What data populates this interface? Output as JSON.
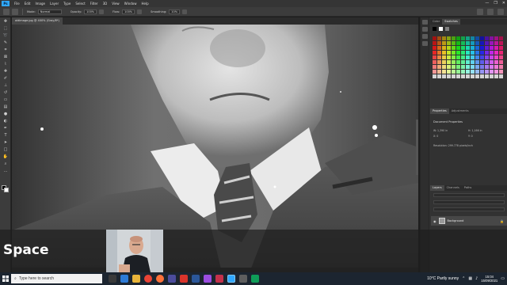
{
  "menubar": {
    "logo": "Ps",
    "items": [
      "File",
      "Edit",
      "Image",
      "Layer",
      "Type",
      "Select",
      "Filter",
      "3D",
      "View",
      "Window",
      "Help"
    ],
    "controls": [
      "—",
      "❐",
      "✕"
    ]
  },
  "options": {
    "mode_label": "Mode:",
    "mode_value": "Normal",
    "opacity_label": "Opacity:",
    "opacity_value": "100%",
    "flow_label": "Flow:",
    "flow_value": "100%",
    "smoothing_label": "Smoothing:",
    "smoothing_value": "10%"
  },
  "document": {
    "tab_label": "oldimage.jpg @ 400% (Gray/8*)"
  },
  "panels": {
    "swatches_tabs": [
      "Color",
      "Swatches"
    ],
    "properties_tabs": [
      "Properties",
      "Adjustments"
    ],
    "properties_title": "Document Properties",
    "prop_lines": [
      "W: 1,390 in",
      "H: 1,166 in",
      "X: 0",
      "Y: 0",
      "Resolution: 299.778 pixels/inch"
    ],
    "layers_tabs": [
      "Layers",
      "Channels",
      "Paths"
    ],
    "layer_name": "Background"
  },
  "overlay": {
    "caption": "Space"
  },
  "taskbar": {
    "search_placeholder": "Type here to search",
    "weather": "10°C  Partly sunny",
    "time": "15:04",
    "date": "15/09/2021"
  },
  "colors": {
    "accent": "#31a8ff",
    "taskbar": "#1c2530"
  }
}
